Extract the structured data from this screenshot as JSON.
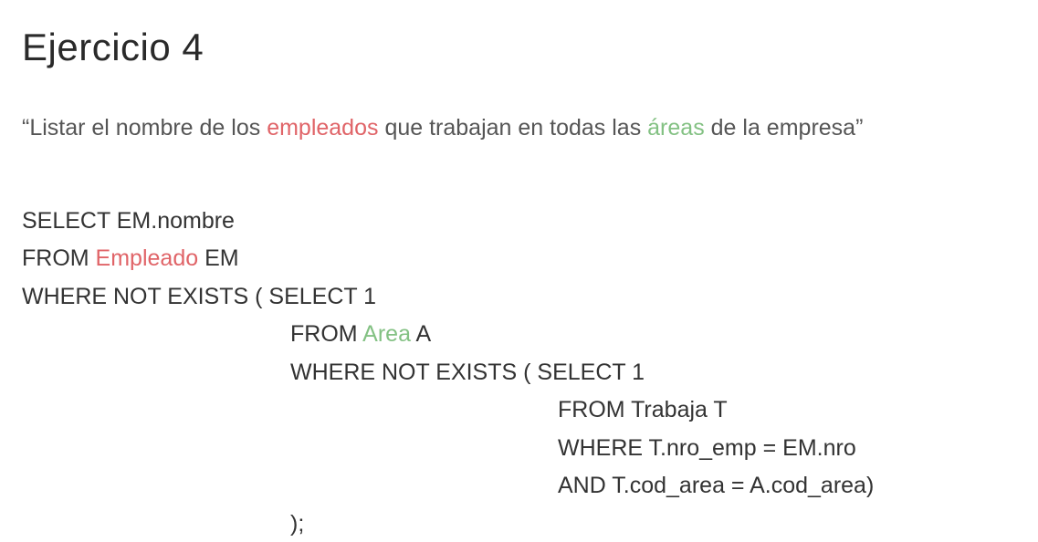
{
  "title": "Ejercicio 4",
  "statement": {
    "open_quote": "“",
    "part1": "Listar el nombre de los ",
    "highlight1": "empleados",
    "part2": " que trabajan en todas las ",
    "highlight2": "áreas",
    "part3": " de la empresa",
    "close_quote": "”"
  },
  "colors": {
    "red_highlight": "#e06468",
    "green_highlight": "#83c183"
  },
  "code": {
    "line1": "SELECT EM.nombre",
    "line2_pre": "FROM ",
    "line2_hl": "Empleado",
    "line2_post": " EM",
    "line3": "WHERE NOT EXISTS ( SELECT 1",
    "line4_pre": "FROM ",
    "line4_hl": "Area",
    "line4_post": " A",
    "line5": "WHERE NOT EXISTS ( SELECT 1",
    "line6": "FROM Trabaja T",
    "line7": "WHERE T.nro_emp = EM.nro",
    "line8": "AND T.cod_area = A.cod_area)",
    "line9": ");"
  }
}
